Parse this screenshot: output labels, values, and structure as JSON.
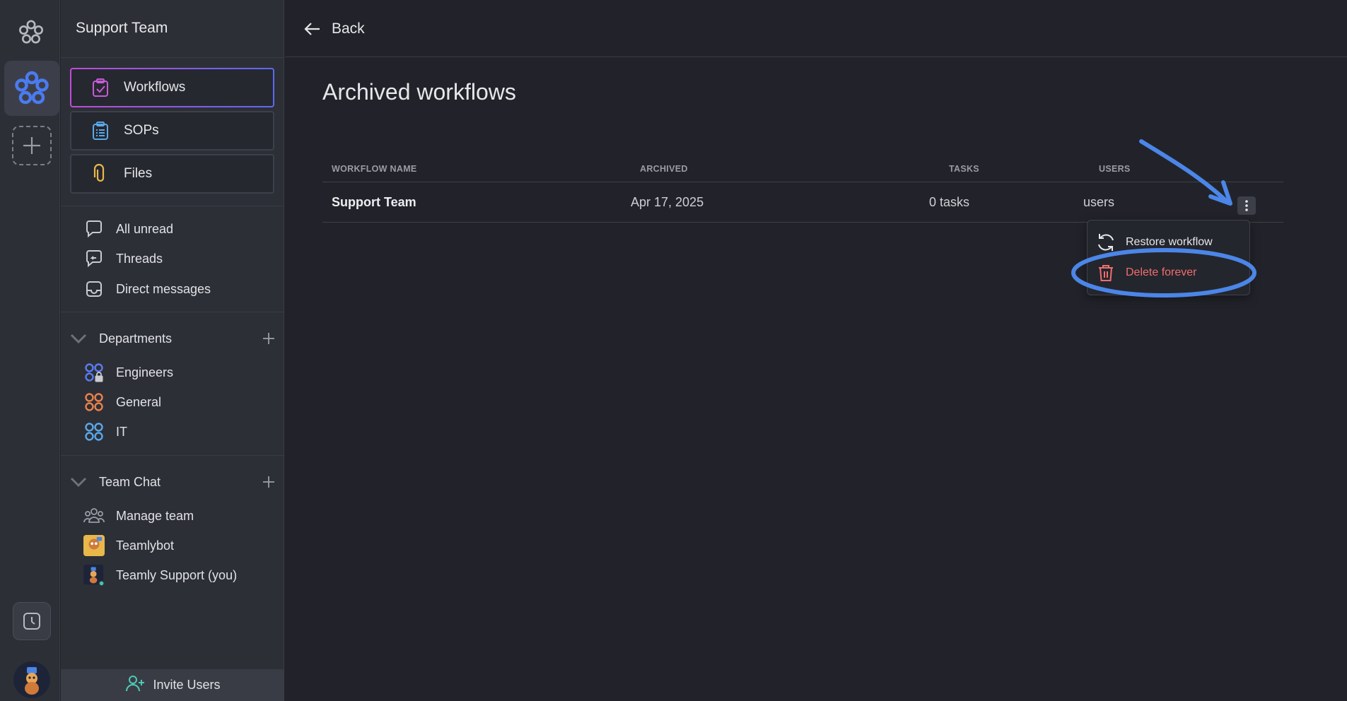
{
  "sidebar": {
    "workspace_title": "Support Team",
    "main_nav": [
      {
        "label": "Workflows",
        "icon": "clipboard-check-icon",
        "active": true
      },
      {
        "label": "SOPs",
        "icon": "list-clipboard-icon",
        "active": false
      },
      {
        "label": "Files",
        "icon": "paperclip-icon",
        "active": false
      }
    ],
    "quick_items": [
      {
        "label": "All unread",
        "icon": "chat-bubble-icon"
      },
      {
        "label": "Threads",
        "icon": "threads-icon"
      },
      {
        "label": "Direct messages",
        "icon": "inbox-icon"
      }
    ],
    "departments": {
      "title": "Departments",
      "items": [
        {
          "label": "Engineers",
          "icon": "private-channel-icon",
          "color": "#5b7cf0"
        },
        {
          "label": "General",
          "icon": "channel-icon",
          "color": "#e8834a"
        },
        {
          "label": "IT",
          "icon": "channel-icon",
          "color": "#5aa8e8"
        }
      ]
    },
    "team_chat": {
      "title": "Team Chat",
      "items": [
        {
          "label": "Manage team",
          "icon": "team-icon"
        },
        {
          "label": "Teamlybot",
          "icon": "bot-avatar"
        },
        {
          "label": "Teamly Support (you)",
          "icon": "user-avatar"
        }
      ]
    },
    "invite_label": "Invite Users"
  },
  "topbar": {
    "back_label": "Back"
  },
  "page": {
    "title": "Archived workflows",
    "table": {
      "headers": [
        "WORKFLOW NAME",
        "ARCHIVED",
        "TASKS",
        "USERS"
      ],
      "rows": [
        {
          "name": "Support Team",
          "archived": "Apr 17, 2025",
          "tasks": "0 tasks",
          "users": "users"
        }
      ]
    },
    "context_menu": {
      "items": [
        {
          "label": "Restore workflow",
          "icon": "refresh-icon"
        },
        {
          "label": "Delete forever",
          "icon": "trash-icon",
          "color": "#ef6e6e"
        }
      ]
    }
  },
  "colors": {
    "background": "#22232a",
    "sidebar": "#2d2f37",
    "accent_blue": "#4b86e8",
    "danger": "#ef6e6e"
  }
}
